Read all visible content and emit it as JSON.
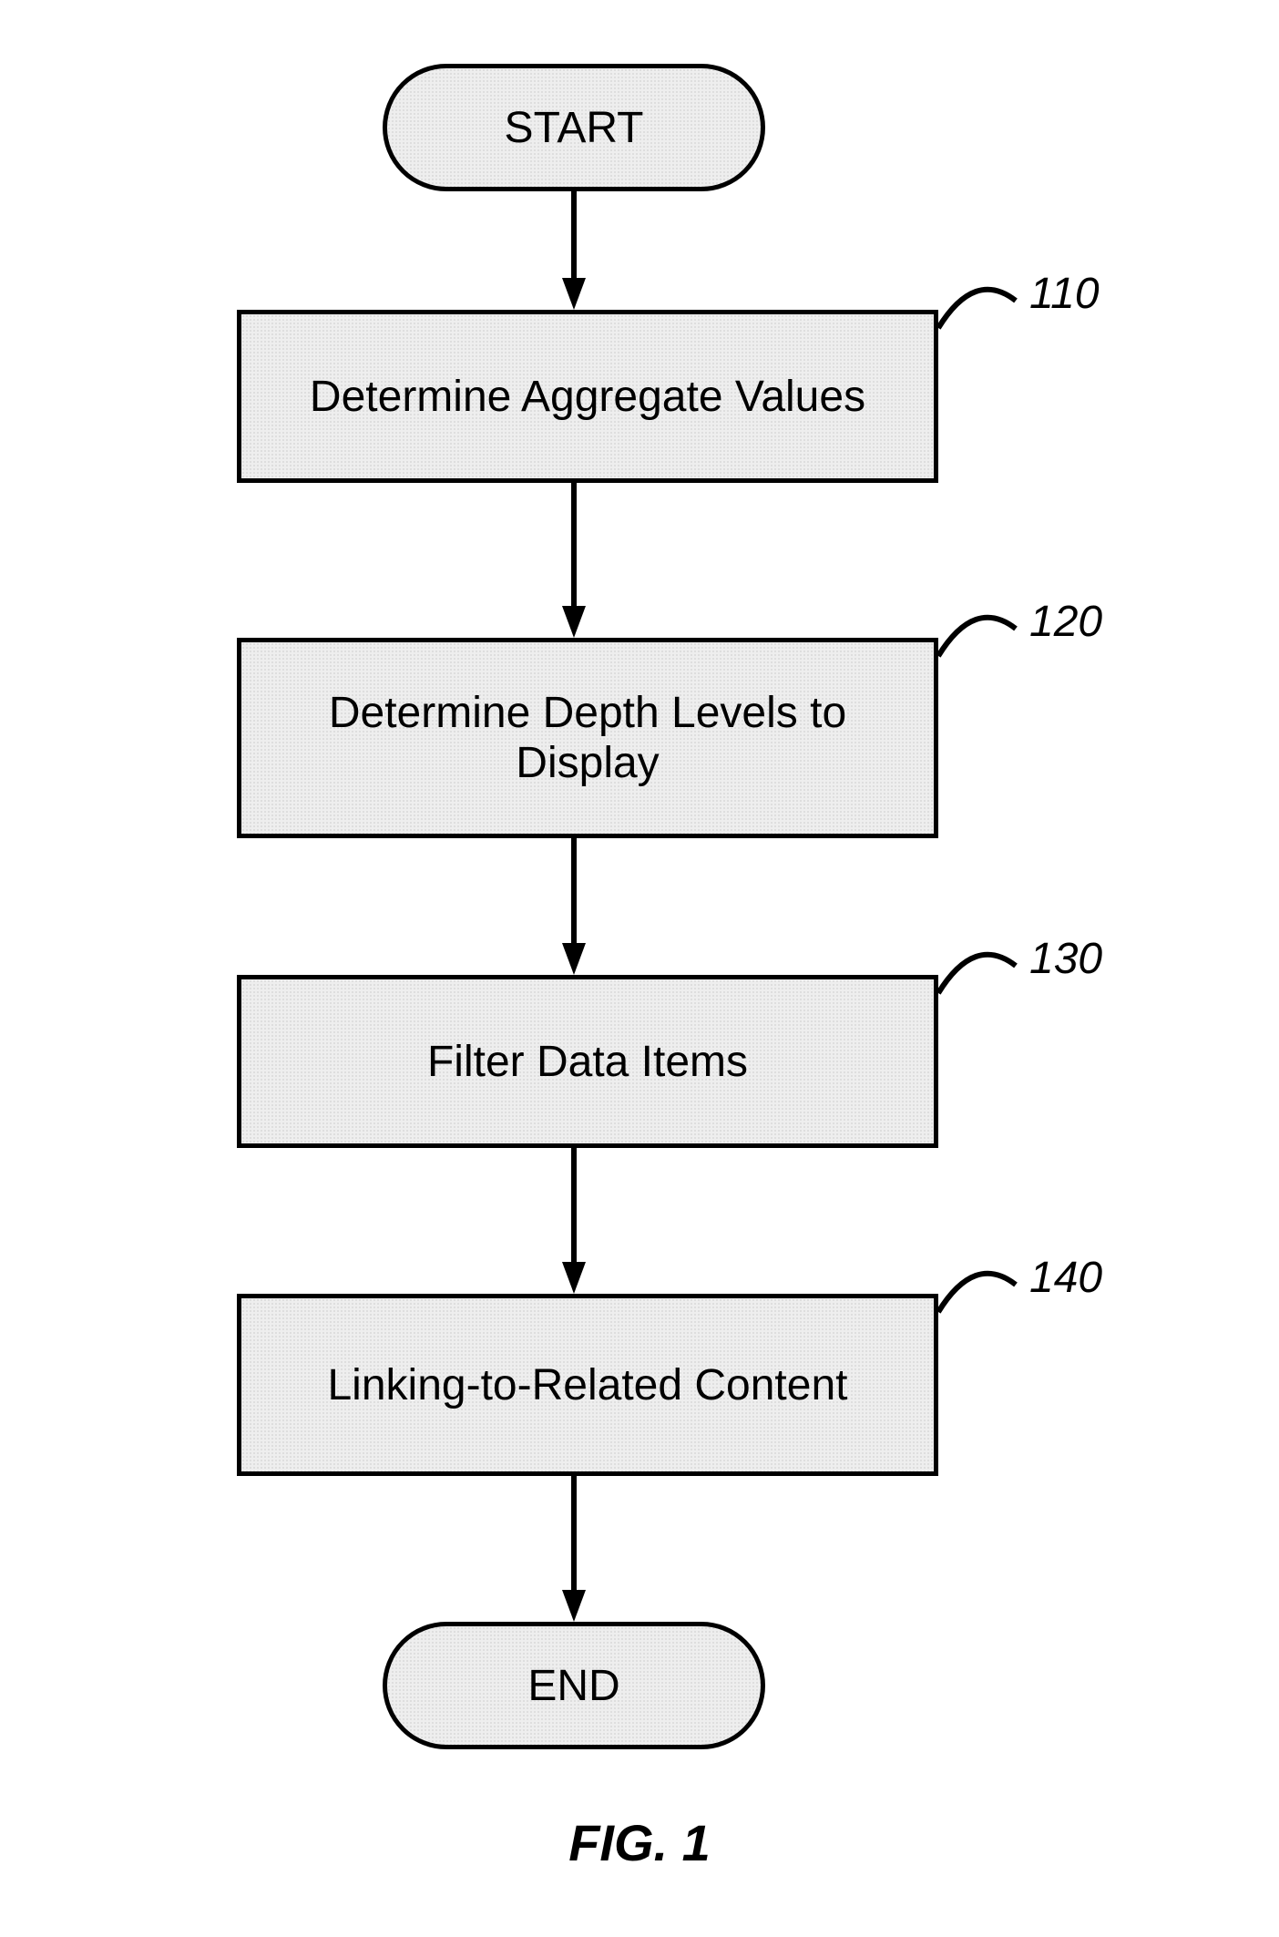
{
  "terminators": {
    "start": "START",
    "end": "END"
  },
  "steps": {
    "s110": {
      "label": "110",
      "text": "Determine Aggregate Values"
    },
    "s120": {
      "label": "120",
      "text": "Determine Depth Levels to Display"
    },
    "s130": {
      "label": "130",
      "text": "Filter Data Items"
    },
    "s140": {
      "label": "140",
      "text": "Linking-to-Related Content"
    }
  },
  "figure_caption": "FIG. 1"
}
